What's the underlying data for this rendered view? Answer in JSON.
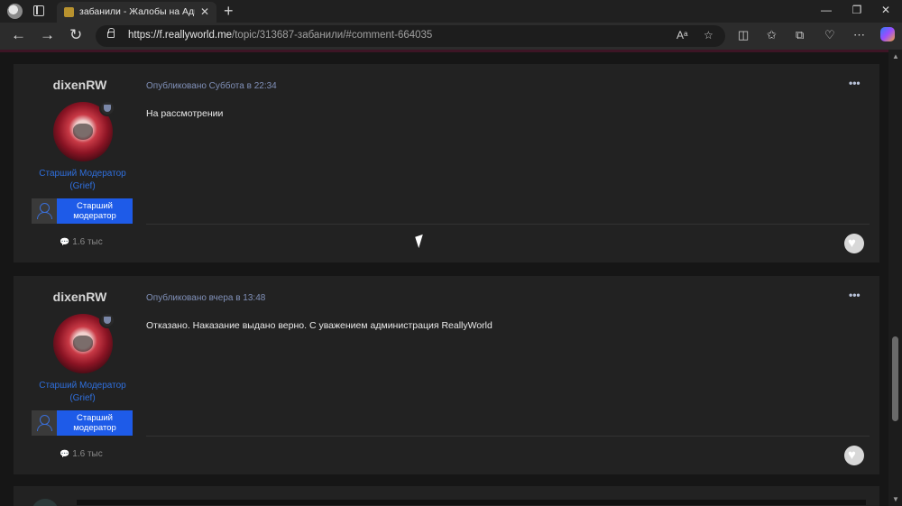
{
  "browser": {
    "tab_title": "забанили - Жалобы на Администрацию",
    "url_domain": "https://f.reallyworld.me",
    "url_path": "/topic/313687-забанили/#comment-664035",
    "new_tab_glyph": "+",
    "close_glyph": "✕",
    "colors": {
      "tabbar": "#202020",
      "toolbar": "#2c2c2c",
      "address": "#1d1d1d"
    }
  },
  "posts": [
    {
      "author": "dixenRW",
      "role": "Старший Модератор (Grief)",
      "group": "Старший модератор",
      "post_count": "1.6 тыс",
      "meta": "Опубликовано Суббота в 22:34",
      "content": "На рассмотрении"
    },
    {
      "author": "dixenRW",
      "role": "Старший Модератор (Grief)",
      "group": "Старший модератор",
      "post_count": "1.6 тыс",
      "meta": "Опубликовано вчера в 13:48",
      "content": "Отказано. Наказание выдано верно. С уважением администрация ReallyWorld"
    }
  ],
  "theme": {
    "page_bg": "#161616",
    "card_bg": "#222222",
    "role_color": "#2f6fdd",
    "group_bg": "#1e5be8"
  },
  "icons": [
    "profile-icon",
    "tab-actions-icon",
    "back-icon",
    "forward-icon",
    "refresh-icon",
    "lock-icon",
    "read-aloud-icon",
    "favorite-icon",
    "split-screen-icon",
    "favorites-icon",
    "collections-icon",
    "performance-icon",
    "more-icon",
    "copilot-icon",
    "comment-icon",
    "like-icon"
  ]
}
